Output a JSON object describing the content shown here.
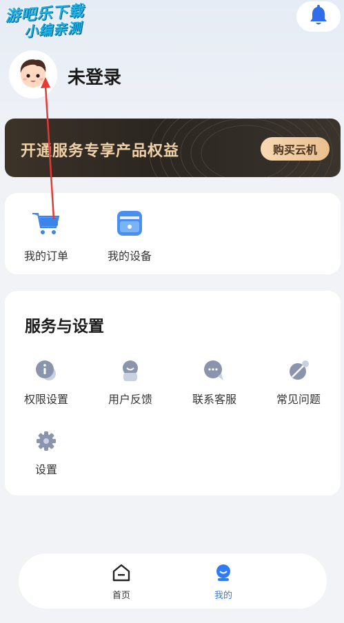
{
  "watermark": {
    "line1": "游吧乐下载",
    "line2": "小编亲测"
  },
  "header": {
    "bell_icon": "bell-icon"
  },
  "profile": {
    "username": "未登录",
    "avatar_icon": "avatar-boy-icon"
  },
  "vip_banner": {
    "text": "开通服务专享产品权益",
    "button_label": "购买云机"
  },
  "quick_entries": [
    {
      "label": "我的订单",
      "icon": "cart-icon"
    },
    {
      "label": "我的设备",
      "icon": "device-icon"
    }
  ],
  "services": {
    "title": "服务与设置",
    "items": [
      {
        "label": "权限设置",
        "icon": "info-icon"
      },
      {
        "label": "用户反馈",
        "icon": "feedback-icon"
      },
      {
        "label": "联系客服",
        "icon": "chat-icon"
      },
      {
        "label": "常见问题",
        "icon": "faq-icon"
      },
      {
        "label": "设置",
        "icon": "gear-icon"
      }
    ]
  },
  "tabbar": {
    "tabs": [
      {
        "label": "首页",
        "icon": "home-icon",
        "active": false
      },
      {
        "label": "我的",
        "icon": "profile-icon",
        "active": true
      }
    ]
  },
  "colors": {
    "accent": "#2f7cf6",
    "banner_bg": "#2b2620",
    "banner_text": "#f1d2a8",
    "icon_gray": "#8a94ad",
    "annotation_arrow": "#e53935"
  }
}
